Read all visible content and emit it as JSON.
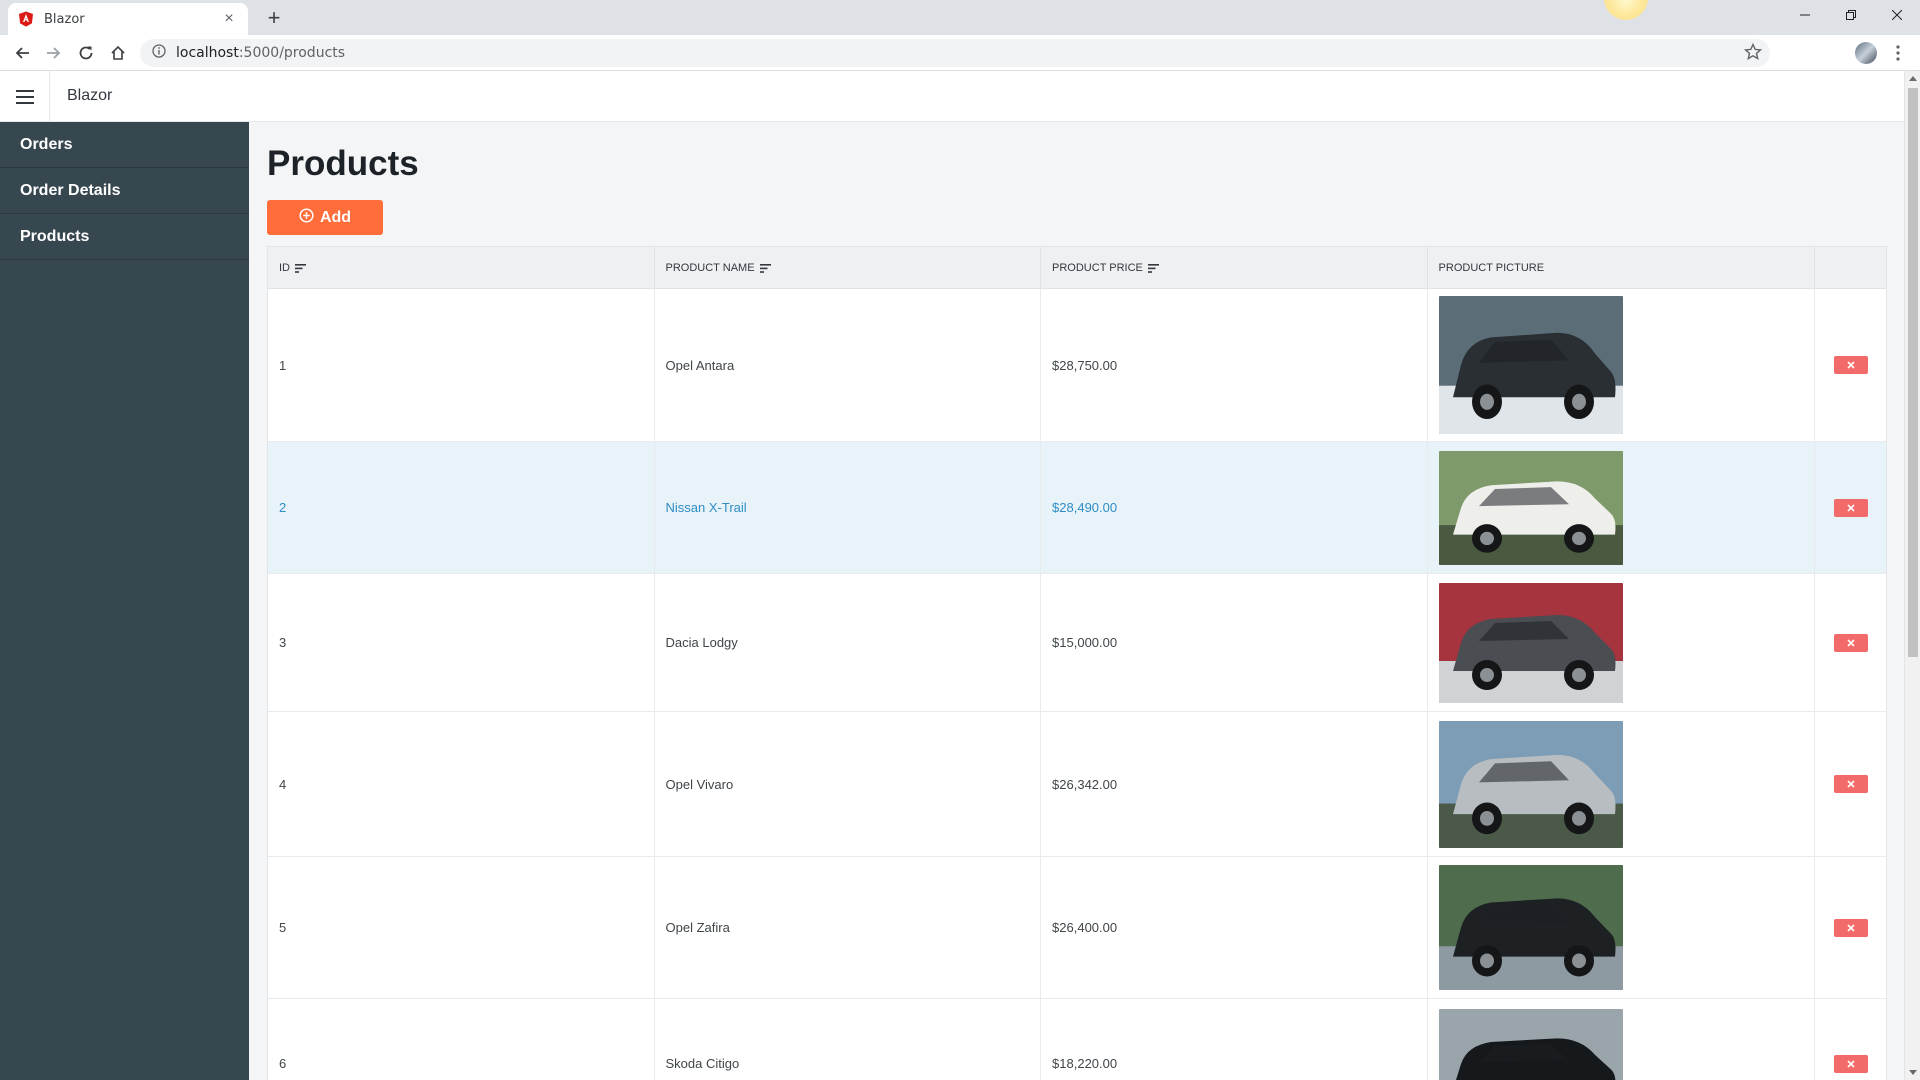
{
  "browser": {
    "tab_title": "Blazor",
    "tab_close": "×",
    "new_tab": "+",
    "url_host": "localhost",
    "url_rest": ":5000/products"
  },
  "app": {
    "brand": "Blazor",
    "sidebar": {
      "items": [
        {
          "label": "Orders"
        },
        {
          "label": "Order Details"
        },
        {
          "label": "Products"
        }
      ]
    },
    "page_title": "Products",
    "add_label": "Add",
    "grid": {
      "columns": [
        {
          "label": "ID",
          "sortable": true
        },
        {
          "label": "Product Name",
          "sortable": true
        },
        {
          "label": "Product Price",
          "sortable": true
        },
        {
          "label": "Product Picture",
          "sortable": false
        }
      ],
      "selected_row": 2,
      "rows": [
        {
          "id": "1",
          "name": "Opel Antara",
          "price": "$28,750.00",
          "picture": "dark-suv-picture"
        },
        {
          "id": "2",
          "name": "Nissan X-Trail",
          "price": "$28,490.00",
          "picture": "white-suv-picture"
        },
        {
          "id": "3",
          "name": "Dacia Lodgy",
          "price": "$15,000.00",
          "picture": "grey-minivan-picture"
        },
        {
          "id": "4",
          "name": "Opel Vivaro",
          "price": "$26,342.00",
          "picture": "silver-van-picture"
        },
        {
          "id": "5",
          "name": "Opel Zafira",
          "price": "$26,400.00",
          "picture": "black-minivan-picture"
        },
        {
          "id": "6",
          "name": "Skoda Citigo",
          "price": "$18,220.00",
          "picture": "black-hatchback-picture"
        }
      ]
    }
  },
  "colors": {
    "accent": "#ff6d3b",
    "sidebar": "#37474f",
    "delete": "#f36a6a",
    "selected_row": "#e8f2f9",
    "selected_text": "#2e8ec4"
  }
}
